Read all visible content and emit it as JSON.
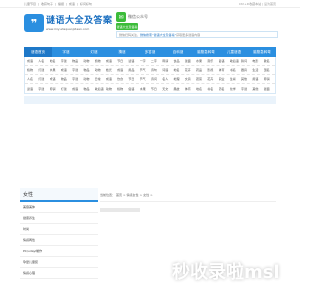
{
  "topbar": {
    "links": [
      "儿童节目",
      "|",
      "收获句子",
      "|",
      "播报",
      "|",
      "成语",
      "|",
      "好词好句"
    ],
    "right": "Ctrl+D收藏本站 | 设为首页"
  },
  "header": {
    "logo_text": "谜语大全及答案",
    "logo_url": "www.miyudaquanjidaan.com",
    "wechat_label": "微信公众号",
    "wechat_box": "谜语大全及答案",
    "wechat_box2": "",
    "banner_prefix": "微信扫码关注",
    "banner_sep": "，",
    "banner_highlight": "微信搜索“谜语大全及答案”",
    "banner_suffix": "获取更多谜语内容"
  },
  "nav": {
    "items": [
      "谜语首页",
      "字谜",
      "灯谜",
      "猜谜",
      "多答谜",
      "百科谜",
      "脑筋急转弯",
      "儿童谜语",
      "脑筋急转弯"
    ]
  },
  "subnav": {
    "rows": [
      [
        "成语",
        "人名",
        "地名",
        "字谜",
        "物品",
        "动物",
        "植物",
        "成语",
        "节日",
        "谚语",
        "一字",
        "二字",
        "称谓",
        "食品",
        "谜面",
        "水果",
        "音乐",
        "俗语",
        "歇后语",
        "猜词",
        "电影",
        "歌名"
      ],
      [
        "植物",
        "灯谜",
        "水果",
        "成语",
        "字谜",
        "物品",
        "动物",
        "姓氏",
        "成语",
        "用品",
        "节气",
        "诗句",
        "词语",
        "地名",
        "花卉",
        "药品",
        "影视",
        "体育",
        "书名",
        "器具",
        "生活",
        "国名"
      ],
      [
        "人名",
        "灯谜",
        "成语",
        "物品",
        "字谜",
        "动物",
        "日常",
        "成语",
        "饮食",
        "节日",
        "节气",
        "诗词",
        "名人",
        "地理",
        "文具",
        "蔬菜",
        "花卉",
        "职业",
        "生肖",
        "其他",
        "用语",
        "称谓"
      ],
      [
        "谚语",
        "字谜",
        "称谓",
        "灯谜",
        "成语",
        "物品",
        "歇后语",
        "动物",
        "植物",
        "俗语",
        "水果",
        "节日",
        "天文",
        "典故",
        "体育",
        "地名",
        "书名",
        "药名",
        "化学",
        "字谜",
        "其他",
        "谜面"
      ]
    ]
  },
  "sidebar": {
    "title": "女性",
    "items": [
      "美容美体",
      "健康养生",
      "时尚",
      "情感两性",
      "PC/udayl制作",
      "孕婴儿童装",
      "情感心理"
    ]
  },
  "content": {
    "crumb": [
      "当前位置：",
      "首页",
      ">",
      "情感女性",
      ">",
      "女性",
      ">"
    ]
  },
  "watermark": "秒收录啦msl"
}
